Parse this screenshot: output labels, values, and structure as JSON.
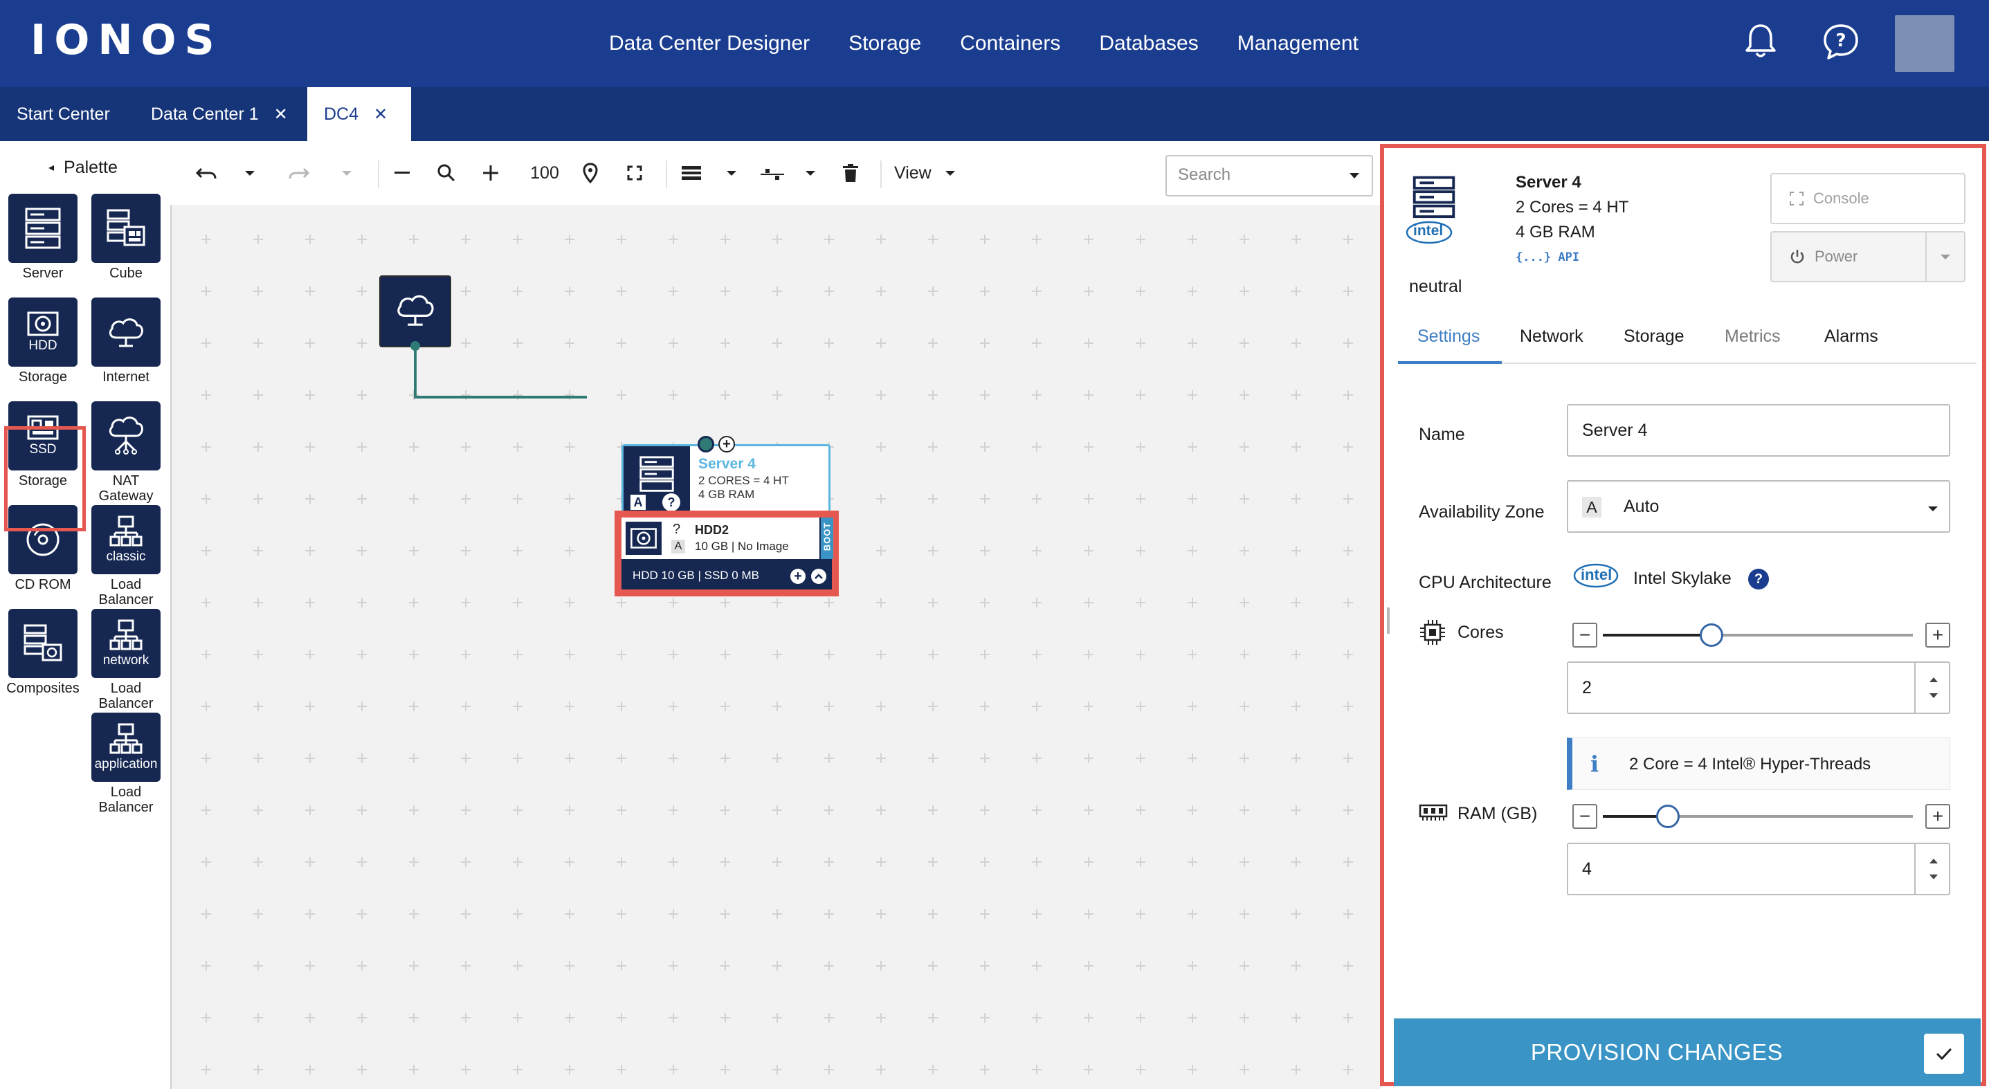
{
  "topnav": {
    "logo": "IONOS",
    "links": [
      "Data Center Designer",
      "Storage",
      "Containers",
      "Databases",
      "Management"
    ],
    "notification_icon": "bell-icon",
    "help_icon": "help-bubble-icon"
  },
  "tabs": [
    {
      "label": "Start Center",
      "closable": false,
      "active": false
    },
    {
      "label": "Data Center 1",
      "closable": true,
      "active": false
    },
    {
      "label": "DC4",
      "closable": true,
      "active": true
    }
  ],
  "palette": {
    "title": "Palette",
    "items": {
      "server": {
        "label": "Server"
      },
      "cube": {
        "label": "Cube"
      },
      "hdd": {
        "inner": "HDD",
        "label": "Storage",
        "highlighted": true
      },
      "internet": {
        "label": "Internet"
      },
      "ssd": {
        "inner": "SSD",
        "label": "Storage"
      },
      "nat": {
        "label": "NAT Gateway"
      },
      "cdrom": {
        "label": "CD ROM"
      },
      "lb_classic": {
        "inner": "classic",
        "label": "Load Balancer"
      },
      "composites": {
        "label": "Composites"
      },
      "lb_network": {
        "inner": "network",
        "label": "Load Balancer"
      },
      "lb_application": {
        "inner": "application",
        "label": "Load Balancer"
      }
    }
  },
  "toolbar": {
    "zoom": "100",
    "view_label": "View",
    "search_placeholder": "Search"
  },
  "canvas": {
    "server_card": {
      "name": "Server 4",
      "cores": "2 CORES = 4 HT",
      "ram": "4 GB RAM",
      "badge_a": "A",
      "badge_q": "?"
    },
    "hdd_card": {
      "question": "?",
      "zone": "A",
      "name": "HDD2",
      "details": "10 GB | No Image",
      "boot": "BOOT",
      "footer": "HDD 10 GB | SSD 0 MB"
    }
  },
  "panel": {
    "server_name": "Server 4",
    "cores_line": "2 Cores = 4 HT",
    "ram_line": "4 GB RAM",
    "api_label": "{...} API",
    "intel_logo": "intel",
    "state": "neutral",
    "console_label": "Console",
    "power_label": "Power",
    "tabs": [
      "Settings",
      "Network",
      "Storage",
      "Metrics",
      "Alarms"
    ],
    "fields": {
      "name_label": "Name",
      "name_value": "Server 4",
      "zone_label": "Availability Zone",
      "zone_badge": "A",
      "zone_value": "Auto",
      "cpu_label": "CPU Architecture",
      "cpu_logo": "intel",
      "cpu_value": "Intel Skylake",
      "cores_label": "Cores",
      "cores_value": "2",
      "cores_slider_fraction": 0.35,
      "info_text": "2 Core = 4 Intel® Hyper-Threads",
      "info_icon": "i",
      "ram_label": "RAM (GB)",
      "ram_value": "4",
      "ram_slider_fraction": 0.21
    },
    "provision_label": "PROVISION CHANGES"
  },
  "colors": {
    "nav_bg": "#1b3d8f",
    "tab_bg": "#163478",
    "palette_icon_bg": "#162852",
    "highlight": "#e5584f",
    "accent": "#3e7ec4",
    "provision_bg": "#3a95c6",
    "connector": "#2f7a74",
    "server_card_border": "#5bb7e0"
  }
}
